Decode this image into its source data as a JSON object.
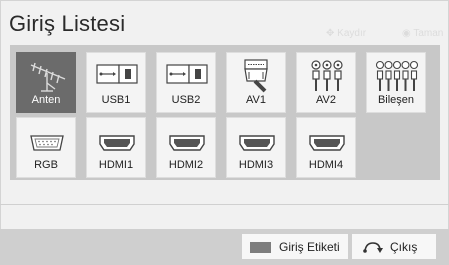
{
  "header": {
    "title": "Giriş Listesi",
    "hint_move": "Kaydır",
    "hint_ok": "Taman"
  },
  "inputs": [
    {
      "label": "Anten",
      "icon": "antenna-icon",
      "selected": true
    },
    {
      "label": "USB1",
      "icon": "usb-icon",
      "selected": false
    },
    {
      "label": "USB2",
      "icon": "usb-icon",
      "selected": false
    },
    {
      "label": "AV1",
      "icon": "scart-icon",
      "selected": false
    },
    {
      "label": "AV2",
      "icon": "rca-icon",
      "selected": false
    },
    {
      "label": "Bileşen",
      "icon": "component-icon",
      "selected": false
    },
    {
      "label": "RGB",
      "icon": "vga-icon",
      "selected": false
    },
    {
      "label": "HDMI1",
      "icon": "hdmi-icon",
      "selected": false
    },
    {
      "label": "HDMI2",
      "icon": "hdmi-icon",
      "selected": false
    },
    {
      "label": "HDMI3",
      "icon": "hdmi-icon",
      "selected": false
    },
    {
      "label": "HDMI4",
      "icon": "hdmi-icon",
      "selected": false
    }
  ],
  "footer": {
    "label_button": "Giriş Etiketi",
    "exit_button": "Çıkış"
  },
  "colors": {
    "selected_tile": "#6b6b6b",
    "grid_background": "#c8c8c8",
    "panel_background": "#f1f1f1"
  }
}
